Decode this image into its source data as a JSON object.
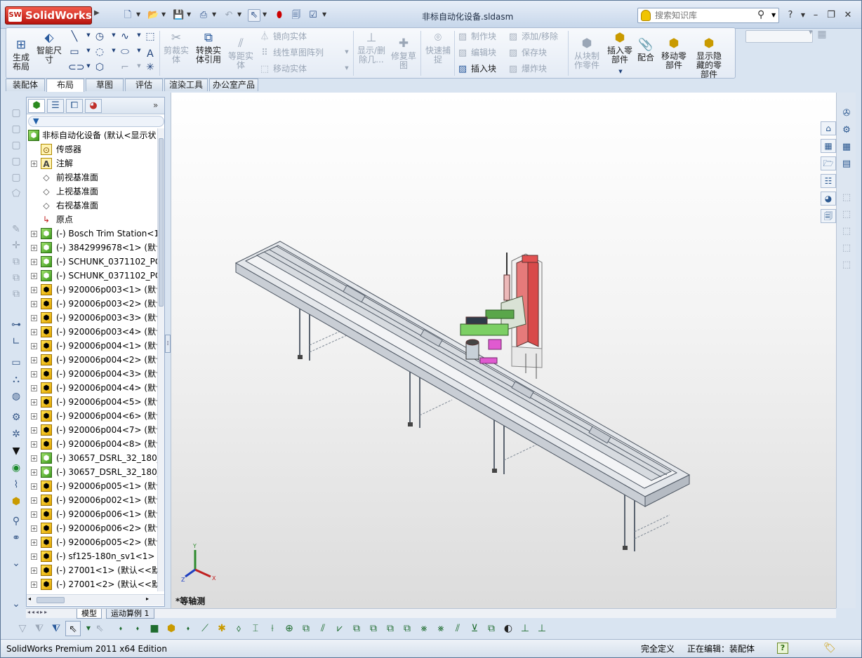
{
  "app": {
    "brand": "SolidWorks",
    "brand_badge": "SW",
    "doc_title": "非标自动化设备.sldasm"
  },
  "search": {
    "placeholder": "搜索知识库"
  },
  "window": {
    "help": "?",
    "minimize": "–",
    "restore": "❐",
    "close": "✕"
  },
  "ribbon": {
    "auto_layout": "生成\n布局",
    "smart_dim": "智能尺\n寸",
    "trim": "剪裁实\n体",
    "convert": "转换实\n体引用",
    "offset": "等距实\n体",
    "mirror": "镜向实体",
    "linear_pattern": "线性草图阵列",
    "move_entities": "移动实体",
    "show_delete": "显示/删\n除几...",
    "repair": "修复草\n图",
    "quick_snap": "快速捕\n捉",
    "make_block": "制作块",
    "edit_block": "编辑块",
    "insert_block": "插入块",
    "add_remove": "添加/移除",
    "save_block": "保存块",
    "explode_block": "爆炸块",
    "make_part": "从块制\n作零件",
    "insert_component": "插入零\n部件",
    "mate": "配合",
    "move_component": "移动零\n部件",
    "show_hidden": "显示隐\n藏的零\n部件"
  },
  "tabs": [
    "装配体",
    "布局",
    "草图",
    "评估",
    "渲染工具",
    "办公室产品"
  ],
  "active_tab": "布局",
  "tree": {
    "root": "非标自动化设备 (默认<显示状",
    "items": [
      {
        "label": "传感器",
        "kind": "sensor",
        "exp": ""
      },
      {
        "label": "注解",
        "kind": "note",
        "exp": "+"
      },
      {
        "label": "前视基准面",
        "kind": "plane",
        "exp": ""
      },
      {
        "label": "上视基准面",
        "kind": "plane",
        "exp": ""
      },
      {
        "label": "右视基准面",
        "kind": "plane",
        "exp": ""
      },
      {
        "label": "原点",
        "kind": "origin",
        "exp": ""
      },
      {
        "label": "(-) Bosch Trim Station<1",
        "kind": "asm",
        "exp": "+"
      },
      {
        "label": "(-) 3842999678<1> (默认",
        "kind": "asm",
        "exp": "+"
      },
      {
        "label": "(-) SCHUNK_0371102_PG",
        "kind": "asm",
        "exp": "+"
      },
      {
        "label": "(-) SCHUNK_0371102_PG",
        "kind": "asm",
        "exp": "+"
      },
      {
        "label": "(-) 920006p003<1> (默认",
        "kind": "part",
        "exp": "+"
      },
      {
        "label": "(-) 920006p003<2> (默认",
        "kind": "part",
        "exp": "+"
      },
      {
        "label": "(-) 920006p003<3> (默认",
        "kind": "part",
        "exp": "+"
      },
      {
        "label": "(-) 920006p003<4> (默认",
        "kind": "part",
        "exp": "+"
      },
      {
        "label": "(-) 920006p004<1> (默认",
        "kind": "part",
        "exp": "+"
      },
      {
        "label": "(-) 920006p004<2> (默认",
        "kind": "part",
        "exp": "+"
      },
      {
        "label": "(-) 920006p004<3> (默认",
        "kind": "part",
        "exp": "+"
      },
      {
        "label": "(-) 920006p004<4> (默认",
        "kind": "part",
        "exp": "+"
      },
      {
        "label": "(-) 920006p004<5> (默认",
        "kind": "part",
        "exp": "+"
      },
      {
        "label": "(-) 920006p004<6> (默认",
        "kind": "part",
        "exp": "+"
      },
      {
        "label": "(-) 920006p004<7> (默认",
        "kind": "part",
        "exp": "+"
      },
      {
        "label": "(-) 920006p004<8> (默认",
        "kind": "part",
        "exp": "+"
      },
      {
        "label": "(-) 30657_DSRL_32_180_F",
        "kind": "asm",
        "exp": "+"
      },
      {
        "label": "(-) 30657_DSRL_32_180_F",
        "kind": "asm",
        "exp": "+"
      },
      {
        "label": "(-) 920006p005<1> (默认",
        "kind": "part",
        "exp": "+"
      },
      {
        "label": "(-) 920006p002<1> (默认",
        "kind": "part",
        "exp": "+"
      },
      {
        "label": "(-) 920006p006<1> (默认",
        "kind": "part",
        "exp": "+"
      },
      {
        "label": "(-) 920006p006<2> (默认",
        "kind": "part",
        "exp": "+"
      },
      {
        "label": "(-) 920006p005<2> (默认",
        "kind": "part",
        "exp": "+"
      },
      {
        "label": "(-) sf125-180n_sv1<1> (默",
        "kind": "part",
        "exp": "+"
      },
      {
        "label": "(-) 27001<1> (默认<<默",
        "kind": "part",
        "exp": "+"
      },
      {
        "label": "(-) 27001<2> (默认<<默",
        "kind": "part",
        "exp": "+"
      }
    ]
  },
  "viewport": {
    "view_label": "*等轴测",
    "axes": {
      "x": "X",
      "y": "Y",
      "z": "Z"
    }
  },
  "bottom_tabs": [
    "模型",
    "运动算例 1"
  ],
  "active_bottom_tab": "模型",
  "status": {
    "edition": "SolidWorks Premium 2011 x64 Edition",
    "definition": "完全定义",
    "editing": "正在编辑：装配体",
    "help": "?"
  },
  "colors": {
    "accent": "#2a5a9c",
    "logo": "#c8261a",
    "tree_part": "#e8b400",
    "tree_asm": "#4caa28",
    "viewport_bg": "#f0f0f0"
  }
}
